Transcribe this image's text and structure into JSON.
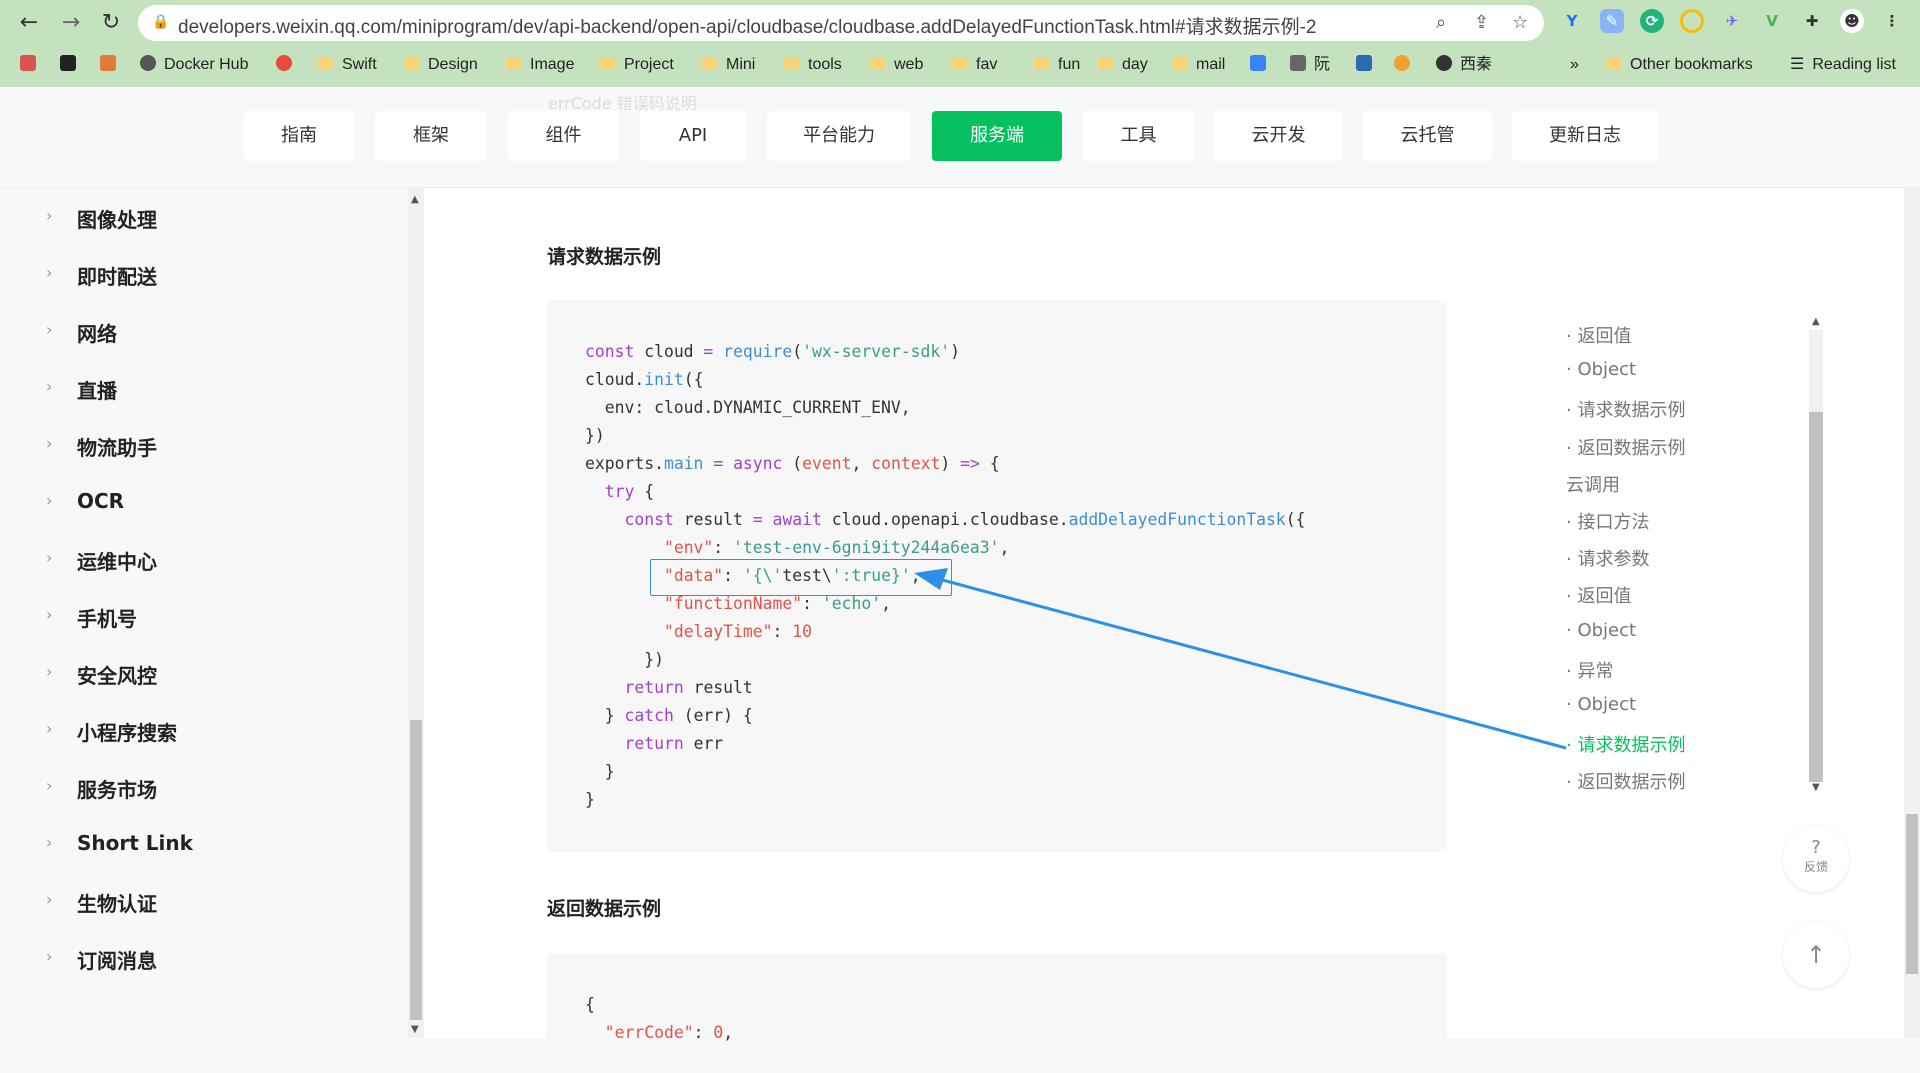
{
  "browser": {
    "url": "developers.weixin.qq.com/miniprogram/dev/api-backend/open-api/cloudbase/cloudbase.addDelayedFunctionTask.html#请求数据示例-2",
    "bookmarks": [
      "Docker Hub",
      "Swift",
      "Design",
      "Image",
      "Project",
      "Mini",
      "tools",
      "web",
      "fav",
      "fun",
      "day",
      "mail",
      "阮",
      "西秦"
    ],
    "overflow": "»",
    "other_bookmarks": "Other bookmarks",
    "reading_list": "Reading list"
  },
  "topnav": {
    "faint_text": "errCode 错误码说明",
    "tabs": [
      "指南",
      "框架",
      "组件",
      "API",
      "平台能力",
      "服务端",
      "工具",
      "云开发",
      "云托管",
      "更新日志"
    ],
    "active": "服务端"
  },
  "sidebar": {
    "items": [
      "图像处理",
      "即时配送",
      "网络",
      "直播",
      "物流助手",
      "OCR",
      "运维中心",
      "手机号",
      "安全风控",
      "小程序搜索",
      "服务市场",
      "Short Link",
      "生物认证",
      "订阅消息"
    ]
  },
  "content": {
    "heading_request": "请求数据示例",
    "heading_response": "返回数据示例",
    "request_code": [
      "const cloud = require('wx-server-sdk')",
      "cloud.init({",
      "  env: cloud.DYNAMIC_CURRENT_ENV,",
      "})",
      "exports.main = async (event, context) => {",
      "  try {",
      "    const result = await cloud.openapi.cloudbase.addDelayedFunctionTask({",
      "        \"env\": 'test-env-6gni9ity244a6ea3',",
      "        \"data\": '{\\'test\\':true}',",
      "        \"functionName\": 'echo',",
      "        \"delayTime\": 10",
      "      })",
      "    return result",
      "  } catch (err) {",
      "    return err",
      "  }",
      "}"
    ],
    "response_code": [
      "{",
      "  \"errCode\": 0,"
    ]
  },
  "toc": {
    "items": [
      "· 返回值",
      "· Object",
      "· 请求数据示例",
      "· 返回数据示例",
      "云调用",
      "· 接口方法",
      "· 请求参数",
      "· 返回值",
      "· Object",
      "· 异常",
      "· Object",
      "· 请求数据示例",
      "· 返回数据示例"
    ],
    "active_index": 11
  },
  "float": {
    "feedback_icon": "?",
    "feedback_label": "反馈",
    "top_icon": "↑"
  },
  "colors": {
    "accent": "#07c160",
    "annotation": "#2e8fe6"
  }
}
